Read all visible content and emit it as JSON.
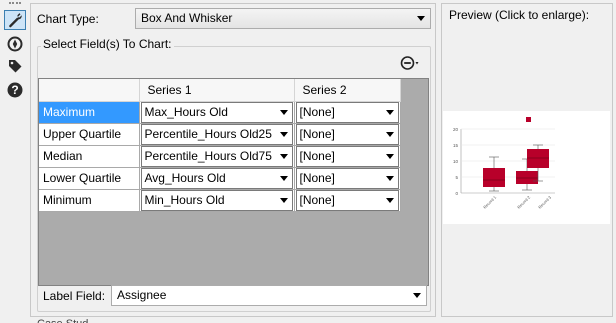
{
  "toolbar": {
    "tools": [
      {
        "icon": "wrench-icon",
        "active": true
      },
      {
        "icon": "compass-icon",
        "active": false
      },
      {
        "icon": "tag-icon",
        "active": false
      },
      {
        "icon": "help-icon",
        "active": false
      }
    ]
  },
  "config": {
    "chart_type_label": "Chart Type:",
    "chart_type_value": "Box And Whisker",
    "select_fields_label": "Select Field(s) To Chart:",
    "label_field_label": "Label Field:",
    "label_field_value": "Assignee",
    "minus_icon": "minus-circle-icon"
  },
  "grid": {
    "columns": [
      "",
      "Series 1",
      "Series 2"
    ],
    "rows": [
      {
        "label": "Maximum",
        "series1": "Max_Hours Old",
        "series2": "[None]",
        "selected": true
      },
      {
        "label": "Upper Quartile",
        "series1": "Percentile_Hours Old25",
        "series2": "[None]"
      },
      {
        "label": "Median",
        "series1": "Percentile_Hours Old75",
        "series2": "[None]"
      },
      {
        "label": "Lower Quartile",
        "series1": "Avg_Hours Old",
        "series2": "[None]"
      },
      {
        "label": "Minimum",
        "series1": "Min_Hours Old",
        "series2": "[None]"
      }
    ]
  },
  "preview": {
    "title": "Preview (Click to enlarge):",
    "y_ticks": [
      "20",
      "15",
      "10",
      "5",
      "0"
    ],
    "x_labels": [
      "Record 1",
      "Record 2",
      "Record 3"
    ],
    "box_color": "#b8002a"
  },
  "bottom_text": "Case Stud..."
}
